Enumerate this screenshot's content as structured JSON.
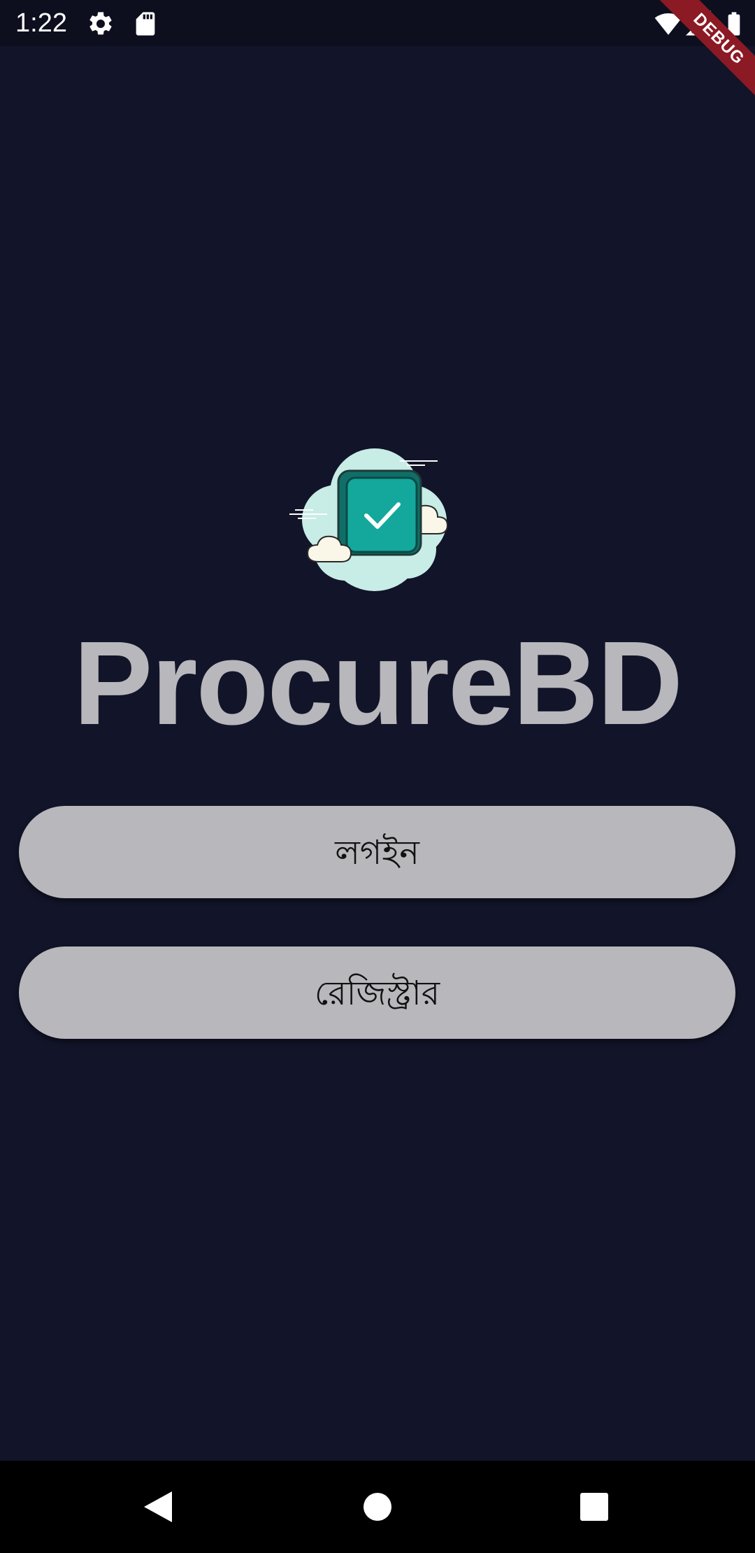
{
  "status_bar": {
    "time": "1:22",
    "icons": [
      "settings-icon",
      "sd-card-icon",
      "wifi-icon",
      "signal-icon",
      "battery-icon"
    ]
  },
  "debug_banner": {
    "label": "DEBUG",
    "color": "#8b1a24"
  },
  "logo": {
    "icon": "checkbox-cloud-logo"
  },
  "app": {
    "title": "ProcureBD"
  },
  "buttons": {
    "login_label": "লগইন",
    "register_label": "রেজিস্ট্রার"
  },
  "nav_bar": {
    "icons": [
      "back-icon",
      "home-icon",
      "recents-icon"
    ]
  },
  "colors": {
    "background": "#121429",
    "button": "#b7b7bc",
    "title": "#b7b7bc",
    "logo_teal": "#14a89c",
    "logo_cloud": "#c8ece6"
  }
}
